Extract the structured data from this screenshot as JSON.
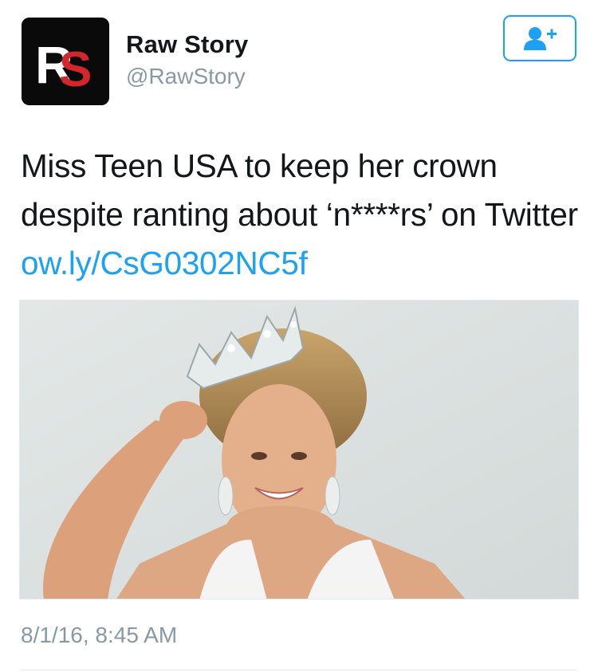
{
  "account": {
    "display_name": "Raw Story",
    "handle": "@RawStory",
    "avatar_logo_text": "RS"
  },
  "follow_button": {
    "icon": "person-add-icon"
  },
  "tweet": {
    "text": "Miss Teen USA to keep her crown despite ranting about ‘n****rs’ on Twitter",
    "link": "ow.ly/CsG0302NC5f",
    "timestamp": "8/1/16, 8:45 AM"
  },
  "colors": {
    "link": "#1da1f2",
    "secondary_text": "#8899a6",
    "brand_red": "#d0262c"
  }
}
